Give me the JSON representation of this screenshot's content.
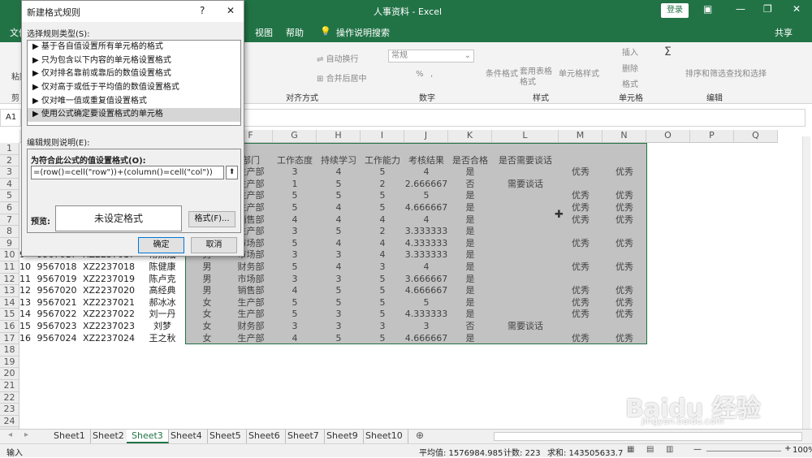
{
  "app": {
    "title": "人事资料 - Excel",
    "login": "登录",
    "share": "共享"
  },
  "menu": {
    "file": "文件",
    "view": "视图",
    "help": "帮助",
    "tellme": "操作说明搜索"
  },
  "ribbon": {
    "paste": "粘贴",
    "cut": "剪",
    "wrap": "自动换行",
    "merge": "合并后居中",
    "align": "对齐方式",
    "numfmt": "常规",
    "number": "数字",
    "cond": "条件格式",
    "table": "套用表格格式",
    "cellstyle": "单元格样式",
    "styles": "样式",
    "insert": "插入",
    "delete": "删除",
    "format": "格式",
    "cells": "单元格",
    "sortfilter": "排序和筛选",
    "findselect": "查找和选择",
    "edit": "编辑",
    "pct": "%",
    "comma": ","
  },
  "namebox": "A1",
  "columns": [
    {
      "id": "F",
      "label": "F"
    },
    {
      "id": "G",
      "label": "G"
    },
    {
      "id": "H",
      "label": "H"
    },
    {
      "id": "I",
      "label": "I"
    },
    {
      "id": "J",
      "label": "J"
    },
    {
      "id": "K",
      "label": "K"
    },
    {
      "id": "L",
      "label": "L"
    },
    {
      "id": "M",
      "label": "M"
    },
    {
      "id": "N",
      "label": "N"
    },
    {
      "id": "O",
      "label": "O"
    },
    {
      "id": "P",
      "label": "P"
    },
    {
      "id": "Q",
      "label": "Q"
    }
  ],
  "row_numbers": [
    "1",
    "2",
    "3",
    "4",
    "5",
    "6",
    "7",
    "8",
    "9",
    "10",
    "11",
    "12",
    "13",
    "14",
    "15",
    "16",
    "17",
    "18",
    "19",
    "20",
    "21",
    "22",
    "23",
    "24",
    "25"
  ],
  "header_row": [
    "部门",
    "工作态度",
    "持续学习",
    "工作能力",
    "考核结果",
    "是否合格",
    "是否需要谈话"
  ],
  "rows_right": [
    [
      "生产部",
      "3",
      "4",
      "5",
      "4",
      "是",
      "",
      "优秀",
      "优秀"
    ],
    [
      "生产部",
      "1",
      "5",
      "2",
      "2.666667",
      "否",
      "需要谈话",
      "",
      ""
    ],
    [
      "生产部",
      "5",
      "5",
      "5",
      "5",
      "是",
      "",
      "优秀",
      "优秀"
    ],
    [
      "生产部",
      "5",
      "4",
      "5",
      "4.666667",
      "是",
      "",
      "优秀",
      "优秀"
    ],
    [
      "销售部",
      "4",
      "4",
      "4",
      "4",
      "是",
      "",
      "优秀",
      "优秀"
    ],
    [
      "生产部",
      "3",
      "5",
      "2",
      "3.333333",
      "是",
      "",
      "",
      ""
    ],
    [
      "市场部",
      "5",
      "4",
      "4",
      "4.333333",
      "是",
      "",
      "优秀",
      "优秀"
    ],
    [
      "市场部",
      "3",
      "3",
      "4",
      "3.333333",
      "是",
      "",
      "",
      ""
    ],
    [
      "财务部",
      "5",
      "4",
      "3",
      "4",
      "是",
      "",
      "优秀",
      "优秀"
    ],
    [
      "市场部",
      "3",
      "3",
      "5",
      "3.666667",
      "是",
      "",
      "",
      ""
    ],
    [
      "销售部",
      "4",
      "5",
      "5",
      "4.666667",
      "是",
      "",
      "优秀",
      "优秀"
    ],
    [
      "生产部",
      "5",
      "5",
      "5",
      "5",
      "是",
      "",
      "优秀",
      "优秀"
    ],
    [
      "生产部",
      "5",
      "3",
      "5",
      "4.333333",
      "是",
      "",
      "优秀",
      "优秀"
    ],
    [
      "财务部",
      "3",
      "3",
      "3",
      "3",
      "否",
      "需要谈话",
      "",
      ""
    ],
    [
      "生产部",
      "4",
      "5",
      "5",
      "4.666667",
      "是",
      "",
      "优秀",
      "优秀"
    ]
  ],
  "rows_left": [
    {
      "row": "10",
      "a": "9",
      "b": "9567017",
      "c": "XZ2237017",
      "d": "常照娥",
      "e": "男"
    },
    {
      "row": "11",
      "a": "10",
      "b": "9567018",
      "c": "XZ2237018",
      "d": "陈健康",
      "e": "男"
    },
    {
      "row": "12",
      "a": "11",
      "b": "9567019",
      "c": "XZ2237019",
      "d": "陈卢克",
      "e": "男"
    },
    {
      "row": "13",
      "a": "12",
      "b": "9567020",
      "c": "XZ2237020",
      "d": "高经典",
      "e": "男"
    },
    {
      "row": "14",
      "a": "13",
      "b": "9567021",
      "c": "XZ2237021",
      "d": "郝冰冰",
      "e": "女"
    },
    {
      "row": "15",
      "a": "14",
      "b": "9567022",
      "c": "XZ2237022",
      "d": "刘一丹",
      "e": "女"
    },
    {
      "row": "16",
      "a": "15",
      "b": "9567023",
      "c": "XZ2237023",
      "d": "刘梦",
      "e": "女"
    },
    {
      "row": "17",
      "a": "16",
      "b": "9567024",
      "c": "XZ2237024",
      "d": "王之秋",
      "e": "女"
    }
  ],
  "sheets": [
    "Sheet1",
    "Sheet2",
    "Sheet3",
    "Sheet4",
    "Sheet5",
    "Sheet6",
    "Sheet7",
    "Sheet9",
    "Sheet10"
  ],
  "active_sheet": "Sheet3",
  "status": {
    "mode": "输入",
    "avg": "平均值: 1576984.985",
    "count": "计数: 223",
    "sum": "求和: 143505633.7",
    "zoom": "100%"
  },
  "dialog": {
    "title": "新建格式规则",
    "help": "?",
    "close": "✕",
    "rule_type_label": "选择规则类型(S):",
    "rule_types": [
      "基于各自值设置所有单元格的格式",
      "只为包含以下内容的单元格设置格式",
      "仅对排名靠前或靠后的数值设置格式",
      "仅对高于或低于平均值的数值设置格式",
      "仅对唯一值或重复值设置格式",
      "使用公式确定要设置格式的单元格"
    ],
    "edit_label": "编辑规则说明(E):",
    "formula_label": "为符合此公式的值设置格式(O):",
    "formula": "=(row()=cell(\"row\"))+(column()=cell(\"col\"))",
    "preview_label": "预览:",
    "preview_text": "未设定格式",
    "format_btn": "格式(F)...",
    "ok": "确定",
    "cancel": "取消"
  },
  "watermark": "Baidu 经验",
  "watermark_url": "jingyan.baidu.com"
}
